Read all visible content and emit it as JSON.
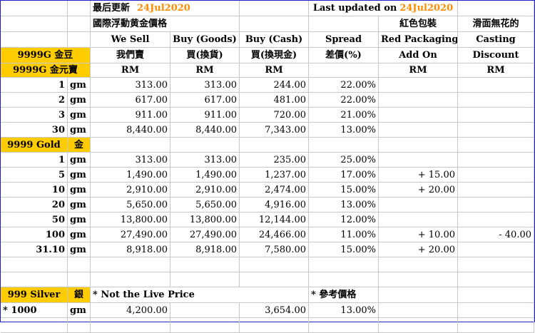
{
  "header": {
    "last_update_cn": "最后更新",
    "date_cn": "24Jul2020",
    "last_updated_en": "Last updated on",
    "date_en": "24Jul2020",
    "subtitle_cn": "國際浮動黄金價格",
    "red_packaging_cn": "紅色包裝",
    "casting_cn": "滑面無花的"
  },
  "columns": {
    "we_sell": "We Sell",
    "we_sell_cn": "我們賣",
    "buy_goods": "Buy (Goods)",
    "buy_goods_cn": "買(換貨)",
    "buy_cash": "Buy (Cash)",
    "buy_cash_cn": "買(換現金)",
    "spread": "Spread",
    "spread_cn": "差價(%)",
    "red_packaging": "Red Packaging",
    "add_on": "Add On",
    "casting": "Casting",
    "discount": "Discount",
    "currency": "RM"
  },
  "sections": {
    "g9999_bean": "9999G 金豆",
    "g9999_ingot": "9999G 金元寶",
    "gold9999": "9999 Gold",
    "gold_cn": "金",
    "silver": "999 Silver",
    "silver_cn": "銀",
    "not_live": "* Not the Live Price",
    "reference": "*  參考價格"
  },
  "unit": "gm",
  "group1": [
    {
      "qty": "1",
      "we_sell": "313.00",
      "buy_goods": "313.00",
      "buy_cash": "244.00",
      "spread": "22.00%",
      "add_on": "",
      "discount": ""
    },
    {
      "qty": "2",
      "we_sell": "617.00",
      "buy_goods": "617.00",
      "buy_cash": "481.00",
      "spread": "22.00%",
      "add_on": "",
      "discount": ""
    },
    {
      "qty": "3",
      "we_sell": "911.00",
      "buy_goods": "911.00",
      "buy_cash": "720.00",
      "spread": "21.00%",
      "add_on": "",
      "discount": ""
    },
    {
      "qty": "30",
      "we_sell": "8,440.00",
      "buy_goods": "8,440.00",
      "buy_cash": "7,343.00",
      "spread": "13.00%",
      "add_on": "",
      "discount": ""
    }
  ],
  "group2": [
    {
      "qty": "1",
      "we_sell": "313.00",
      "buy_goods": "313.00",
      "buy_cash": "235.00",
      "spread": "25.00%",
      "add_on": "",
      "discount": ""
    },
    {
      "qty": "5",
      "we_sell": "1,490.00",
      "buy_goods": "1,490.00",
      "buy_cash": "1,237.00",
      "spread": "17.00%",
      "add_on": "+ 15.00",
      "discount": ""
    },
    {
      "qty": "10",
      "we_sell": "2,910.00",
      "buy_goods": "2,910.00",
      "buy_cash": "2,474.00",
      "spread": "15.00%",
      "add_on": "+ 20.00",
      "discount": ""
    },
    {
      "qty": "20",
      "we_sell": "5,650.00",
      "buy_goods": "5,650.00",
      "buy_cash": "4,916.00",
      "spread": "13.00%",
      "add_on": "",
      "discount": ""
    },
    {
      "qty": "50",
      "we_sell": "13,800.00",
      "buy_goods": "13,800.00",
      "buy_cash": "12,144.00",
      "spread": "12.00%",
      "add_on": "",
      "discount": ""
    },
    {
      "qty": "100",
      "we_sell": "27,490.00",
      "buy_goods": "27,490.00",
      "buy_cash": "24,466.00",
      "spread": "11.00%",
      "add_on": "+ 10.00",
      "discount": "- 40.00"
    },
    {
      "qty": "31.10",
      "we_sell": "8,918.00",
      "buy_goods": "8,918.00",
      "buy_cash": "7,580.00",
      "spread": "15.00%",
      "add_on": "+ 20.00",
      "discount": ""
    }
  ],
  "silver_row": {
    "qty": "*   1000",
    "we_sell": "4,200.00",
    "buy_goods": "",
    "buy_cash": "3,654.00",
    "spread": "13.00%",
    "add_on": "",
    "discount": ""
  },
  "colors": {
    "gold": "#ffcc00",
    "date": "#ff8c00",
    "border": "#1f1fcc"
  }
}
